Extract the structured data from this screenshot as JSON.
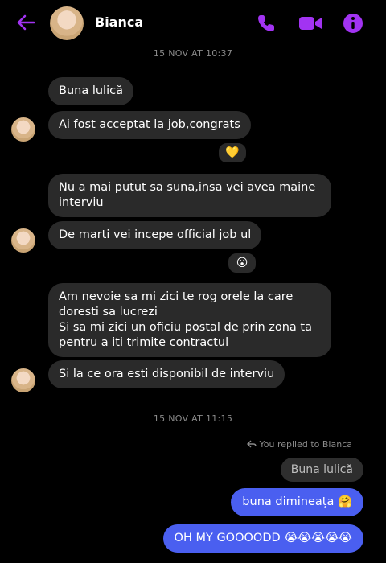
{
  "header": {
    "contact_name": "Bianca",
    "back_icon": "arrow-left-icon",
    "call_icon": "phone-icon",
    "video_icon": "video-camera-icon",
    "info_icon": "info-icon",
    "accent_color": "#a233f2"
  },
  "timestamps": [
    "15 NOV AT 10:37",
    "15 NOV AT 11:15"
  ],
  "messages_in": [
    "Buna lulică",
    "Ai fost acceptat la job,congrats",
    "Nu a mai putut sa suna,insa vei avea maine interviu",
    "De marti vei incepe official job ul",
    "Am nevoie sa mi zici te rog orele la care doresti sa lucrezi\nSi sa mi zici un oficiu postal de prin zona ta pentru a iti trimite contractul",
    "Si la ce ora esti disponibil de interviu"
  ],
  "reactions": [
    "💛",
    "😮"
  ],
  "reply": {
    "note": "You replied to Bianca",
    "quoted": "Buna lulică"
  },
  "messages_out": [
    "buna dimineața 🤗",
    "OH MY GOOOODD 😭😭😭😭😭"
  ],
  "colors": {
    "outgoing_bubble": "#4a5ff0",
    "incoming_bubble": "#2a2a2a",
    "background": "#000000"
  }
}
